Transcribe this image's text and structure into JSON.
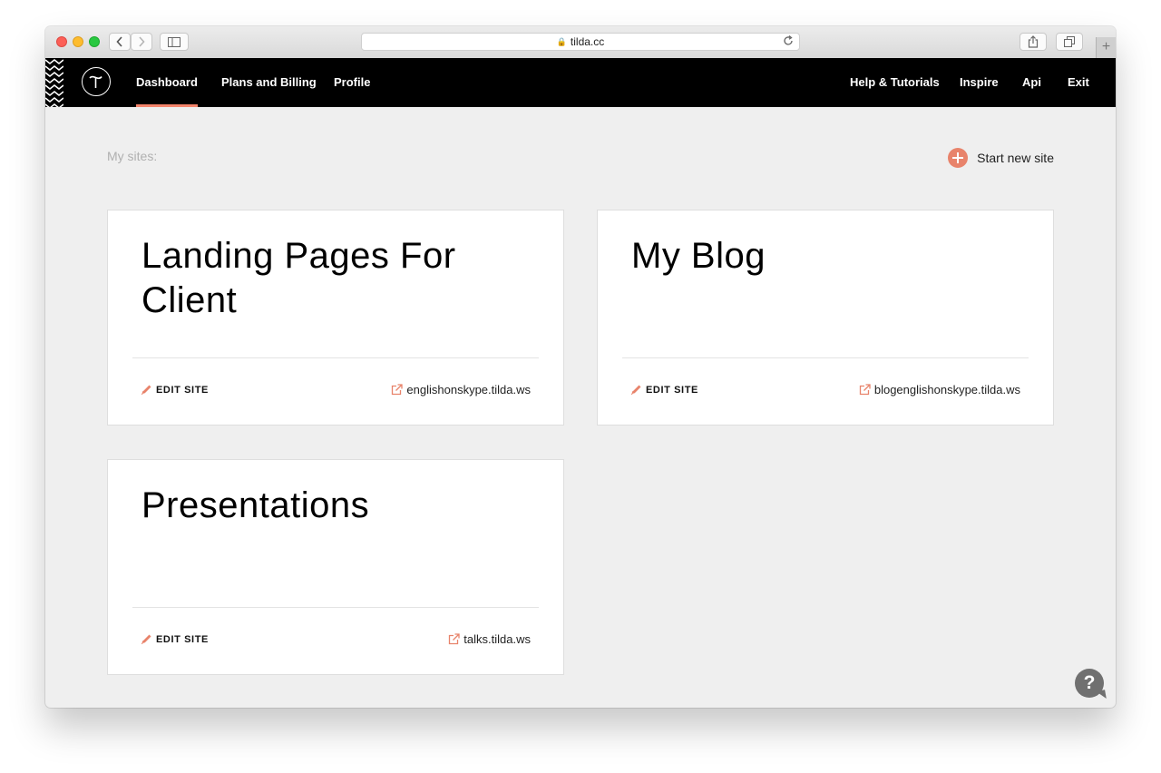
{
  "browser": {
    "url": "tilda.cc",
    "new_tab_label": "+"
  },
  "nav": {
    "logo_icon": "tilda-logo-icon",
    "left_items": [
      {
        "label": "Dashboard",
        "active": true
      },
      {
        "label": "Plans and Billing",
        "active": false
      },
      {
        "label": "Profile",
        "active": false
      }
    ],
    "right_items": [
      {
        "label": "Help & Tutorials"
      },
      {
        "label": "Inspire"
      },
      {
        "label": "Api"
      },
      {
        "label": "Exit"
      }
    ]
  },
  "main": {
    "my_sites_label": "My sites:",
    "start_new_site_label": "Start new site"
  },
  "sites": [
    {
      "title": "Landing Pages For Client",
      "edit_label": "EDIT SITE",
      "url": "englishonskype.tilda.ws"
    },
    {
      "title": "My Blog",
      "edit_label": "EDIT SITE",
      "url": "blogenglishonskype.tilda.ws"
    },
    {
      "title": "Presentations",
      "edit_label": "EDIT SITE",
      "url": "talks.tilda.ws"
    }
  ],
  "help": {
    "label": "?"
  },
  "colors": {
    "accent": "#f4846b",
    "nav_bg": "#000000",
    "page_bg": "#efefef"
  }
}
